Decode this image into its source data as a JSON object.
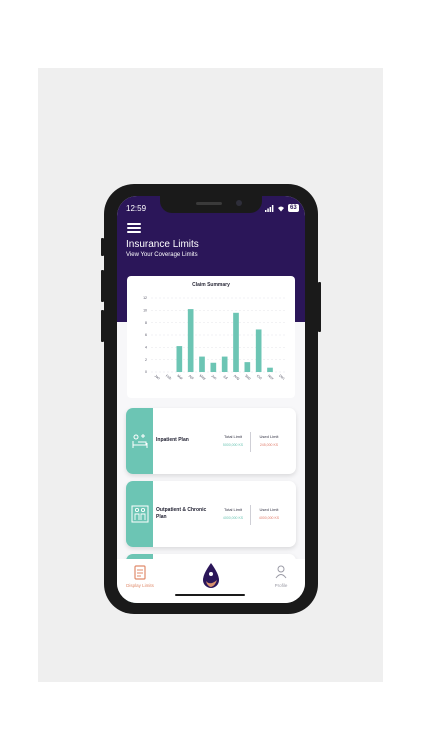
{
  "status_bar": {
    "time": "12:59",
    "signal": "signal-icon",
    "wifi": "wifi-icon",
    "battery": "63"
  },
  "header": {
    "title": "Insurance Limits",
    "subtitle": "View Your Coverage Limits",
    "menu_icon": "hamburger-menu-icon"
  },
  "chart_data": {
    "type": "bar",
    "title": "Claim Summary",
    "categories": [
      "Jan",
      "Feb",
      "Mar",
      "Apr",
      "May",
      "Jun",
      "Jul",
      "Aug",
      "Sep",
      "Oct",
      "Nov",
      "Dec"
    ],
    "values": [
      0,
      0,
      4.2,
      10.2,
      2.5,
      1.5,
      2.5,
      9.6,
      1.6,
      6.9,
      0.7,
      0
    ],
    "ytick_labels": [
      "0",
      "2",
      "4",
      "6",
      "8",
      "10",
      "12"
    ],
    "ylim": [
      0,
      12
    ],
    "grid": true,
    "bar_color": "#6cc5b4"
  },
  "plans": [
    {
      "name": "Inpatient Plan",
      "total_label": "Total Limit",
      "total_value": "5000,000 KS",
      "used_label": "Used Limit",
      "used_value": "245,000 KS",
      "icon": "hospital-bed-icon"
    },
    {
      "name": "Outpatient & Chronic Plan",
      "total_label": "Total Limit",
      "total_value": "4000,000 KS",
      "used_label": "Used Limit",
      "used_value": "4000,000 KS",
      "icon": "doctor-patient-icon"
    }
  ],
  "nav": {
    "left_label": "Display Limits",
    "left_icon": "document-list-icon",
    "center_icon": "drop-logo-icon",
    "right_label": "Profile",
    "right_icon": "person-icon"
  },
  "colors": {
    "header": "#2b1659",
    "accent": "#6cc5b4",
    "used": "#e07b6a",
    "active_nav": "#e08a6a"
  }
}
